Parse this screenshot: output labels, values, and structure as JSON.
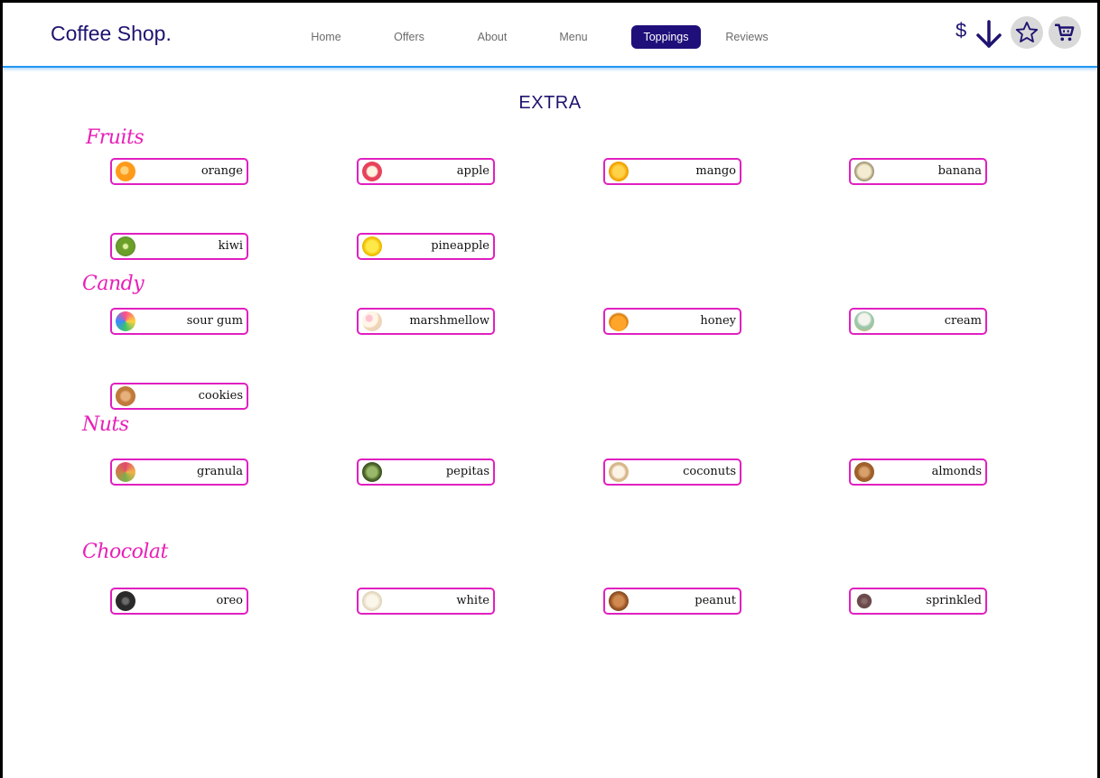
{
  "header": {
    "logo": "Coffee Shop.",
    "nav": [
      {
        "label": "Home"
      },
      {
        "label": "Offers"
      },
      {
        "label": "About"
      },
      {
        "label": "Menu"
      },
      {
        "label": "Toppings",
        "active": true
      },
      {
        "label": "Reviews"
      }
    ],
    "currency_symbol": "$",
    "icons": [
      "sort-down-icon",
      "star-icon",
      "cart-icon"
    ]
  },
  "page": {
    "title": "EXTRA"
  },
  "categories": [
    {
      "name": "Fruits",
      "items": [
        "orange",
        "apple",
        "mango",
        "banana",
        "kiwi",
        "pineapple"
      ]
    },
    {
      "name": "Candy",
      "items": [
        "sour gum",
        "marshmellow",
        "honey",
        "cream",
        "cookies"
      ]
    },
    {
      "name": "Nuts",
      "items": [
        "granula",
        "pepitas",
        "coconuts",
        "almonds"
      ]
    },
    {
      "name": "Chocolat",
      "items": [
        "oreo",
        "white",
        "peanut",
        "sprinkled"
      ]
    }
  ],
  "colors": {
    "brand": "#1e1470",
    "accent": "#1f0f7a",
    "category": "#e820b8",
    "item_border": "#e020c0",
    "header_line": "#2196f3"
  }
}
